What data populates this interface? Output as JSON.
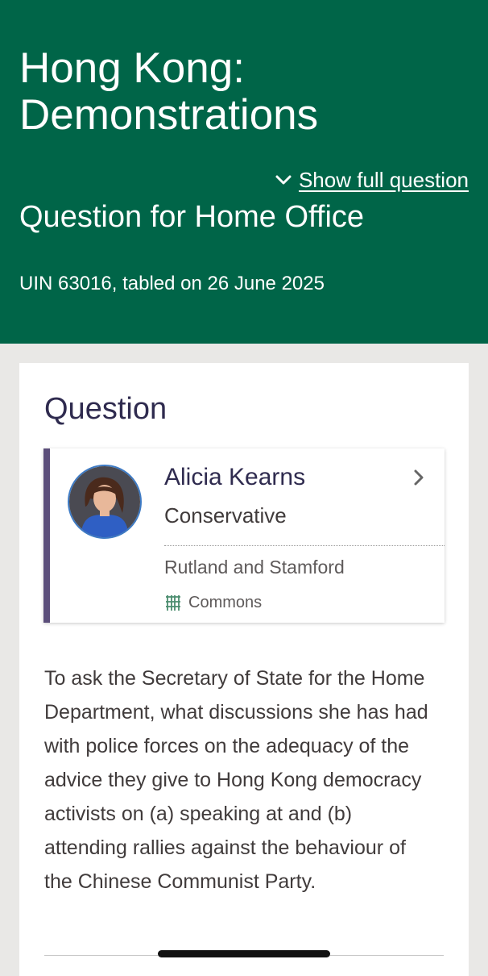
{
  "header": {
    "title": "Hong Kong: Demonstrations",
    "show_full_label": "Show full question",
    "question_for": "Question for Home Office",
    "uin_line": "UIN 63016, tabled on 26 June 2025"
  },
  "question_section": {
    "heading": "Question",
    "member": {
      "name": "Alicia Kearns",
      "party": "Conservative",
      "constituency": "Rutland and Stamford",
      "house": "Commons"
    },
    "text": "To ask the Secretary of State for the Home Department, what discussions she has had with police forces on the adequacy of the advice they give to Hong Kong democracy activists on (a) speaking at and (b) attending rallies against the behaviour of the Chinese Communist Party."
  },
  "colors": {
    "header_green": "#006548",
    "member_accent": "#5b4e7a",
    "heading_text": "#2f2b4f",
    "commons_green": "#4a8c6e"
  },
  "icons": {
    "show_full": "chevron-down-icon",
    "member_link": "chevron-right-icon",
    "house": "portcullis-icon"
  }
}
